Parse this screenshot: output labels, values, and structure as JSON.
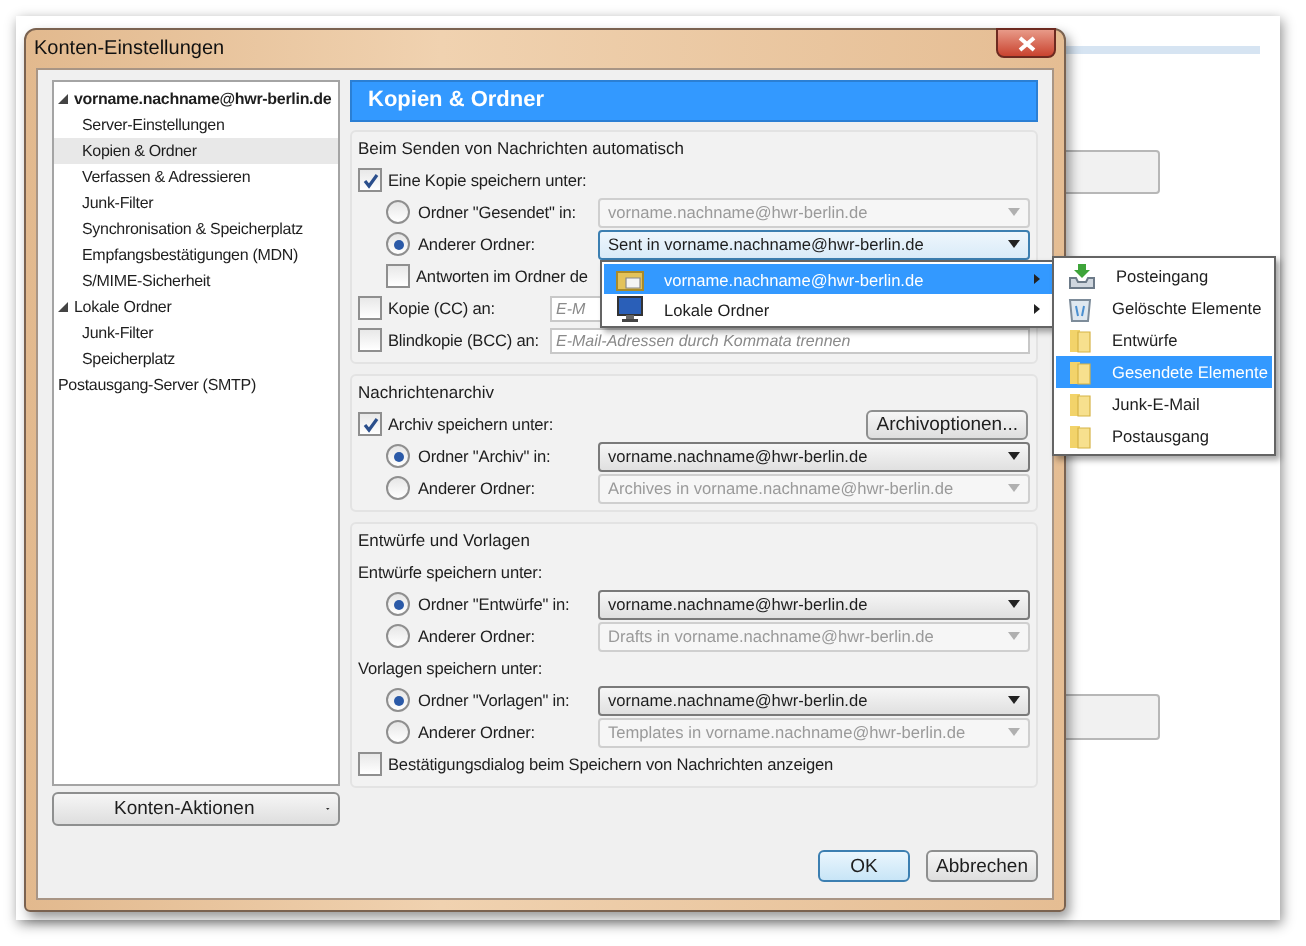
{
  "window": {
    "title": "Konten-Einstellungen"
  },
  "sidebar": {
    "tree": [
      {
        "label": "vorname.nachname@hwr-berlin.de",
        "kind": "mail-account",
        "expanded": true,
        "selected": false,
        "children": [
          {
            "label": "Server-Einstellungen",
            "selected": false
          },
          {
            "label": "Kopien & Ordner",
            "selected": true
          },
          {
            "label": "Verfassen & Adressieren",
            "selected": false
          },
          {
            "label": "Junk-Filter",
            "selected": false
          },
          {
            "label": "Synchronisation & Speicherplatz",
            "selected": false
          },
          {
            "label": "Empfangsbestätigungen (MDN)",
            "selected": false
          },
          {
            "label": "S/MIME-Sicherheit",
            "selected": false
          }
        ]
      },
      {
        "label": "Lokale Ordner",
        "kind": "local-folders",
        "expanded": true,
        "selected": false,
        "children": [
          {
            "label": "Junk-Filter",
            "selected": false
          },
          {
            "label": "Speicherplatz",
            "selected": false
          }
        ]
      },
      {
        "label": "Postausgang-Server (SMTP)",
        "kind": "server",
        "selected": false
      }
    ],
    "button": "Konten-Aktionen"
  },
  "panel": {
    "title": "Kopien & Ordner",
    "sections": [
      {
        "legend": "Beim Senden von Nachrichten automatisch",
        "rows": [
          {
            "kind": "checkbox",
            "label": "Eine Kopie speichern unter:",
            "checked": true,
            "children": [
              {
                "kind": "radio",
                "label": "Ordner \"Gesendet\" in:",
                "selected": false,
                "select": {
                  "value": "vorname.nachname@hwr-berlin.de",
                  "disabled": true,
                  "focused": false
                }
              },
              {
                "kind": "radio",
                "label": "Anderer Ordner:",
                "selected": true,
                "select": {
                  "value": "Sent in vorname.nachname@hwr-berlin.de",
                  "disabled": false,
                  "focused": true
                }
              },
              {
                "kind": "checkbox",
                "label": "Antworten im Ordner de",
                "checked": false
              }
            ]
          },
          {
            "kind": "address",
            "label": "Kopie (CC) an:",
            "checked": false,
            "placeholder": "E-M"
          },
          {
            "kind": "address",
            "label": "Blindkopie (BCC) an:",
            "checked": false,
            "placeholder": "E-Mail-Adressen durch Kommata trennen"
          }
        ]
      },
      {
        "legend": "Nachrichtenarchiv",
        "rows": [
          {
            "kind": "checkbox",
            "label": "Archiv speichern unter:",
            "checked": true,
            "button": "Archivoptionen...",
            "children": [
              {
                "kind": "radio",
                "label": "Ordner \"Archiv\" in:",
                "selected": true,
                "select": {
                  "value": "vorname.nachname@hwr-berlin.de",
                  "disabled": false,
                  "focused": false
                }
              },
              {
                "kind": "radio",
                "label": "Anderer Ordner:",
                "selected": false,
                "select": {
                  "value": "Archives in vorname.nachname@hwr-berlin.de",
                  "disabled": true,
                  "focused": false
                }
              }
            ]
          }
        ]
      },
      {
        "legend": "Entwürfe und Vorlagen",
        "rows": [
          {
            "kind": "subheading",
            "label": "Entwürfe speichern unter:",
            "children": [
              {
                "kind": "radio",
                "label": "Ordner \"Entwürfe\" in:",
                "selected": true,
                "select": {
                  "value": "vorname.nachname@hwr-berlin.de",
                  "disabled": false,
                  "focused": false
                }
              },
              {
                "kind": "radio",
                "label": "Anderer Ordner:",
                "selected": false,
                "select": {
                  "value": "Drafts in vorname.nachname@hwr-berlin.de",
                  "disabled": true,
                  "focused": false
                }
              }
            ]
          },
          {
            "kind": "subheading",
            "label": "Vorlagen speichern unter:",
            "children": [
              {
                "kind": "radio",
                "label": "Ordner \"Vorlagen\" in:",
                "selected": true,
                "select": {
                  "value": "vorname.nachname@hwr-berlin.de",
                  "disabled": false,
                  "focused": false
                }
              },
              {
                "kind": "radio",
                "label": "Anderer Ordner:",
                "selected": false,
                "select": {
                  "value": "Templates in vorname.nachname@hwr-berlin.de",
                  "disabled": true,
                  "focused": false
                }
              }
            ]
          },
          {
            "kind": "checkbox",
            "label": "Bestätigungsdialog beim Speichern von Nachrichten anzeigen",
            "checked": false
          }
        ]
      }
    ]
  },
  "buttons": [
    {
      "label": "OK",
      "default": true
    },
    {
      "label": "Abbrechen",
      "default": false
    }
  ],
  "folder_menu": {
    "items": [
      {
        "label": "vorname.nachname@hwr-berlin.de",
        "kind": "account",
        "selected": true,
        "submenu": true
      },
      {
        "label": "Lokale Ordner",
        "kind": "computer",
        "selected": false,
        "submenu": true
      }
    ]
  },
  "submenu": {
    "items": [
      {
        "label": "Posteingang",
        "kind": "inbox",
        "selected": false
      },
      {
        "label": "Gelöschte Elemente",
        "kind": "trash",
        "selected": false
      },
      {
        "label": "Entwürfe",
        "kind": "folder",
        "selected": false
      },
      {
        "label": "Gesendete Elemente",
        "kind": "folder",
        "selected": true
      },
      {
        "label": "Junk-E-Mail",
        "kind": "folder",
        "selected": false
      },
      {
        "label": "Postausgang",
        "kind": "folder",
        "selected": false
      }
    ]
  }
}
